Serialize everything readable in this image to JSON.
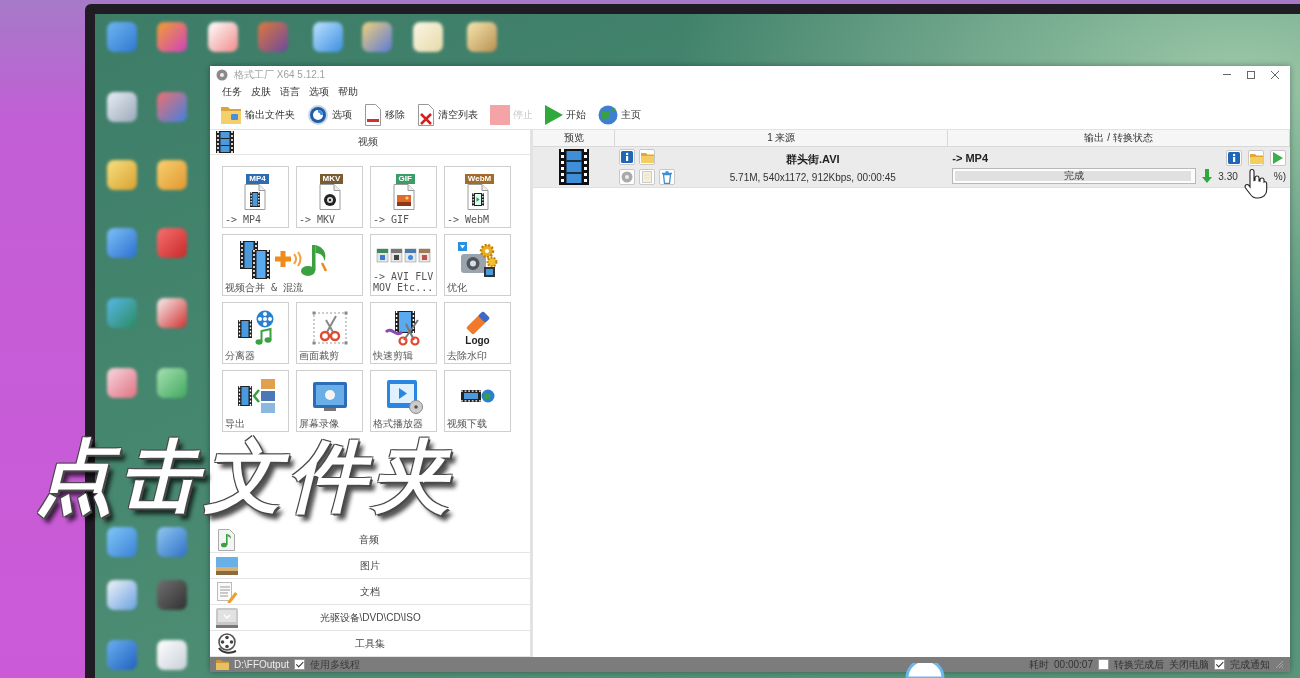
{
  "window": {
    "title": "格式工厂 X64 5.12.1"
  },
  "menu": [
    "任务",
    "皮肤",
    "语言",
    "选项",
    "帮助"
  ],
  "toolbar": [
    {
      "kind": "folder",
      "label": "输出文件夹",
      "disabled": false
    },
    {
      "kind": "options",
      "label": "选项",
      "disabled": false
    },
    {
      "kind": "remove",
      "label": "移除",
      "disabled": false
    },
    {
      "kind": "clear",
      "label": "清空列表",
      "disabled": false
    },
    {
      "kind": "stop",
      "label": "停止",
      "disabled": true
    },
    {
      "kind": "start",
      "label": "开始",
      "disabled": false
    },
    {
      "kind": "home",
      "label": "主页",
      "disabled": false
    }
  ],
  "sidebar": {
    "section": {
      "title": "视频"
    },
    "tools": [
      {
        "kind": "mp4",
        "badge": "MP4",
        "label": "-> MP4"
      },
      {
        "kind": "mkv",
        "badge": "MKV",
        "label": "-> MKV"
      },
      {
        "kind": "gif",
        "badge": "GIF",
        "label": "-> GIF"
      },
      {
        "kind": "webm",
        "badge": "WebM",
        "label": "-> WebM"
      },
      {
        "kind": "merge",
        "label": "视频合并 & 混流"
      },
      {
        "kind": "formats",
        "label": "-> AVI FLV MOV Etc..."
      },
      {
        "kind": "optimize",
        "label": "优化"
      },
      {
        "kind": "splitter",
        "label": "分离器"
      },
      {
        "kind": "crop",
        "label": "画面裁剪"
      },
      {
        "kind": "quickclip",
        "label": "快速剪辑"
      },
      {
        "kind": "watermark",
        "badge": "Logo",
        "label": "去除水印"
      },
      {
        "kind": "export",
        "label": "导出"
      },
      {
        "kind": "record",
        "label": "屏幕录像"
      },
      {
        "kind": "player",
        "label": "格式播放器"
      },
      {
        "kind": "download",
        "label": "视频下载"
      }
    ],
    "categories": [
      {
        "kind": "audio",
        "label": "音频"
      },
      {
        "kind": "image",
        "label": "图片"
      },
      {
        "kind": "document",
        "label": "文档"
      },
      {
        "kind": "disc",
        "label": "光驱设备\\DVD\\CD\\ISO"
      },
      {
        "kind": "toolbox",
        "label": "工具集"
      }
    ]
  },
  "task_list": {
    "columns": [
      "预览",
      "1 来源",
      "输出 / 转换状态"
    ],
    "rows": [
      {
        "name": "群头街.AVI",
        "details": "5.71M, 540x1172, 912Kbps, 00:00:45",
        "output": "-> MP4",
        "status": "完成",
        "level": 1,
        "size": "3.30",
        "size_end": "%)"
      }
    ]
  },
  "status_bar": {
    "folder": "D:\\FFOutput",
    "multithread": {
      "label": "使用多线程",
      "checked": true
    },
    "elapsed_label": "耗时",
    "elapsed": "00:00:07",
    "shutdown": {
      "label": "转换完成后",
      "checked": false
    },
    "shutdown_action": "关闭电脑",
    "notify": {
      "label": "完成通知",
      "checked": true
    }
  },
  "caption": {
    "text": "点击文件夹"
  }
}
